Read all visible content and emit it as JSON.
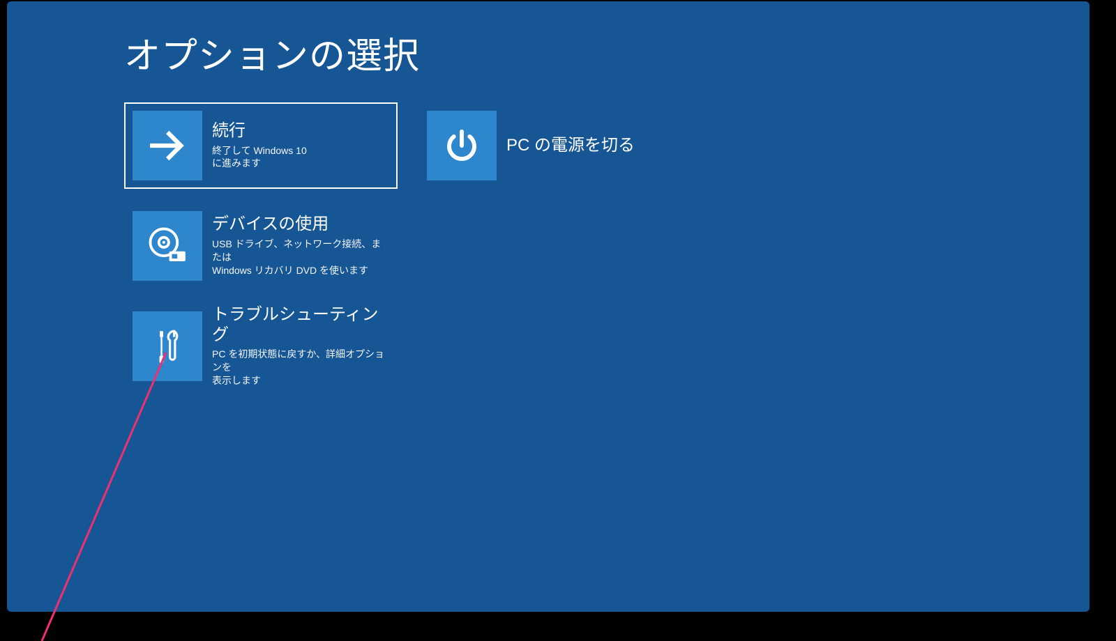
{
  "title": "オプションの選択",
  "tiles": {
    "continue": {
      "title": "続行",
      "sub": "終了して Windows 10\nに進みます"
    },
    "use_device": {
      "title": "デバイスの使用",
      "sub": "USB ドライブ、ネットワーク接続、または\nWindows リカバリ DVD を使います"
    },
    "troubleshoot": {
      "title": "トラブルシューティング",
      "sub": "PC を初期状態に戻すか、詳細オプションを\n表示します"
    },
    "power_off": {
      "title": "PC の電源を切る"
    }
  }
}
